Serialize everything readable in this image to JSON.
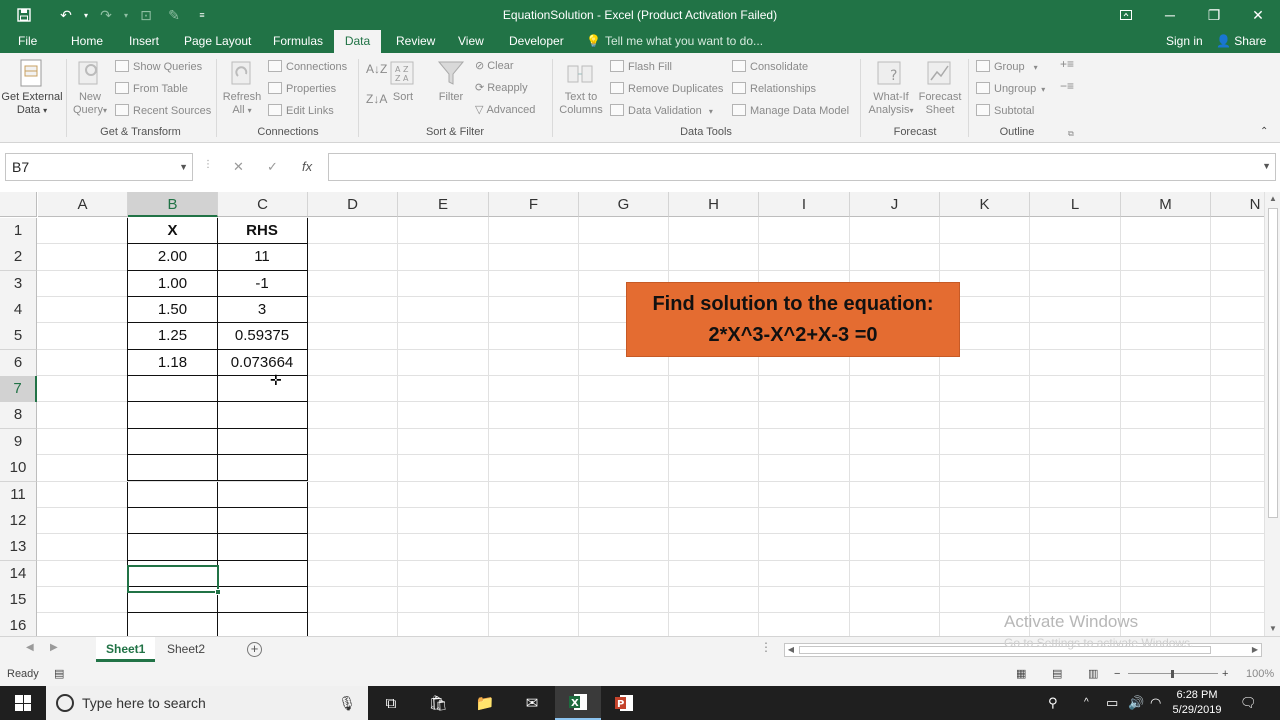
{
  "window": {
    "title": "EquationSolution - Excel (Product Activation Failed)",
    "accent": "#217346"
  },
  "tabs": [
    "File",
    "Home",
    "Insert",
    "Page Layout",
    "Formulas",
    "Data",
    "Review",
    "View",
    "Developer"
  ],
  "active_tab": "Data",
  "tell_me": "Tell me what you want to do...",
  "sign_in": "Sign in",
  "share": "Share",
  "ribbon": {
    "get_external_data": [
      "Get External",
      "Data"
    ],
    "new_query": [
      "New",
      "Query"
    ],
    "show_queries": "Show Queries",
    "from_table": "From Table",
    "recent_sources": "Recent Sources",
    "refresh_all": [
      "Refresh",
      "All"
    ],
    "connections": "Connections",
    "properties": "Properties",
    "edit_links": "Edit Links",
    "sort": "Sort",
    "filter": "Filter",
    "clear": "Clear",
    "reapply": "Reapply",
    "advanced": "Advanced",
    "text_to_columns": [
      "Text to",
      "Columns"
    ],
    "flash_fill": "Flash Fill",
    "remove_duplicates": "Remove Duplicates",
    "data_validation": "Data Validation",
    "consolidate": "Consolidate",
    "relationships": "Relationships",
    "manage_data_model": "Manage Data Model",
    "what_if": [
      "What-If",
      "Analysis"
    ],
    "forecast_sheet": [
      "Forecast",
      "Sheet"
    ],
    "group": "Group",
    "ungroup": "Ungroup",
    "subtotal": "Subtotal",
    "groups": {
      "get_transform": "Get & Transform",
      "connections": "Connections",
      "sort_filter": "Sort & Filter",
      "data_tools": "Data Tools",
      "forecast": "Forecast",
      "outline": "Outline"
    }
  },
  "name_box": "B7",
  "formula": "",
  "columns": [
    "A",
    "B",
    "C",
    "D",
    "E",
    "F",
    "G",
    "H",
    "I",
    "J",
    "K",
    "L",
    "M",
    "N"
  ],
  "selected_column": "B",
  "rows": [
    "1",
    "2",
    "3",
    "4",
    "5",
    "6",
    "7",
    "8",
    "9",
    "10",
    "11",
    "12",
    "13",
    "14",
    "15",
    "16"
  ],
  "selected_row": "7",
  "table": {
    "headers": [
      "X",
      "RHS"
    ],
    "rows": [
      [
        "2.00",
        "11"
      ],
      [
        "1.00",
        "-1"
      ],
      [
        "1.50",
        "3"
      ],
      [
        "1.25",
        "0.59375"
      ],
      [
        "1.18",
        "0.073664"
      ]
    ]
  },
  "shape": {
    "line1": "Find solution to the equation:",
    "line2": "2*X^3-X^2+X-3 =0",
    "fill": "#e46c31"
  },
  "sheets": [
    "Sheet1",
    "Sheet2"
  ],
  "active_sheet": "Sheet1",
  "status": "Ready",
  "zoom": "100%",
  "watermark": {
    "title": "Activate Windows",
    "subtitle": "Go to Settings to activate Windows."
  },
  "taskbar": {
    "search_placeholder": "Type here to search",
    "time": "6:28 PM",
    "date": "5/29/2019"
  }
}
